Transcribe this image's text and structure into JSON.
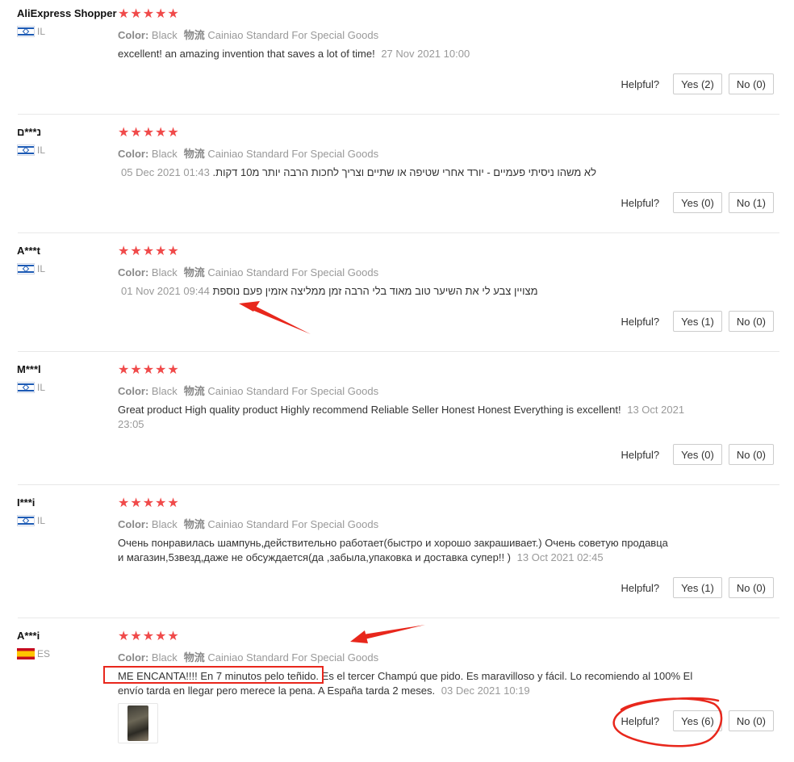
{
  "colors": {
    "star": "#f04a4a",
    "annotation": "#e8271c"
  },
  "helpful_label": "Helpful?",
  "reviews": [
    {
      "user": "AliExpress Shopper",
      "country": "IL",
      "stars": "★★★★★",
      "color_label": "Color:",
      "color_value": "Black",
      "ship_label": "物流",
      "ship_value": "Cainiao Standard For Special Goods",
      "text": "excellent! an amazing invention that saves a lot of time!",
      "date": "27 Nov 2021 10:00",
      "yes": "Yes (2)",
      "no": "No (0)"
    },
    {
      "user": "נ***ם",
      "country": "IL",
      "stars": "★★★★★",
      "color_label": "Color:",
      "color_value": "Black",
      "ship_label": "物流",
      "ship_value": "Cainiao Standard For Special Goods",
      "text": "לא משהו ניסיתי פעמיים - יורד אחרי שטיפה או שתיים וצריך לחכות הרבה יותר מ10 דקות.",
      "date": "05 Dec 2021 01:43",
      "yes": "Yes (0)",
      "no": "No (1)"
    },
    {
      "user": "A***t",
      "country": "IL",
      "stars": "★★★★★",
      "color_label": "Color:",
      "color_value": "Black",
      "ship_label": "物流",
      "ship_value": "Cainiao Standard For Special Goods",
      "text": "מצויין צבע לי את השיער טוב מאוד בלי הרבה זמן ממליצה אזמין פעם נוספת",
      "date": "01 Nov 2021 09:44",
      "yes": "Yes (1)",
      "no": "No (0)"
    },
    {
      "user": "M***l",
      "country": "IL",
      "stars": "★★★★★",
      "color_label": "Color:",
      "color_value": "Black",
      "ship_label": "物流",
      "ship_value": "Cainiao Standard For Special Goods",
      "text": "Great product High quality product Highly recommend Reliable Seller Honest Honest Everything is excellent!",
      "date": "13 Oct 2021 23:05",
      "yes": "Yes (0)",
      "no": "No (0)"
    },
    {
      "user": "I***i",
      "country": "IL",
      "stars": "★★★★★",
      "color_label": "Color:",
      "color_value": "Black",
      "ship_label": "物流",
      "ship_value": "Cainiao Standard For Special Goods",
      "text": "Очень понравилась шампунь,действительно работает(быстро и хорошо закрашивает.) Очень советую продавца и магазин,5звезд,даже не обсуждается(да ,забыла,упаковка и доставка супер!! )",
      "date": "13 Oct 2021 02:45",
      "yes": "Yes (1)",
      "no": "No (0)"
    },
    {
      "user": "A***i",
      "country": "ES",
      "stars": "★★★★★",
      "color_label": "Color:",
      "color_value": "Black",
      "ship_label": "物流",
      "ship_value": "Cainiao Standard For Special Goods",
      "text": "ME ENCANTA!!!! En 7 minutos pelo teñido. Es el tercer Champú que pido. Es maravilloso y fácil. Lo recomiendo al 100% El envío tarda en llegar pero merece la pena. A España tarda 2 meses.",
      "date": "03 Dec 2021 10:19",
      "yes": "Yes (6)",
      "no": "No (0)"
    }
  ]
}
